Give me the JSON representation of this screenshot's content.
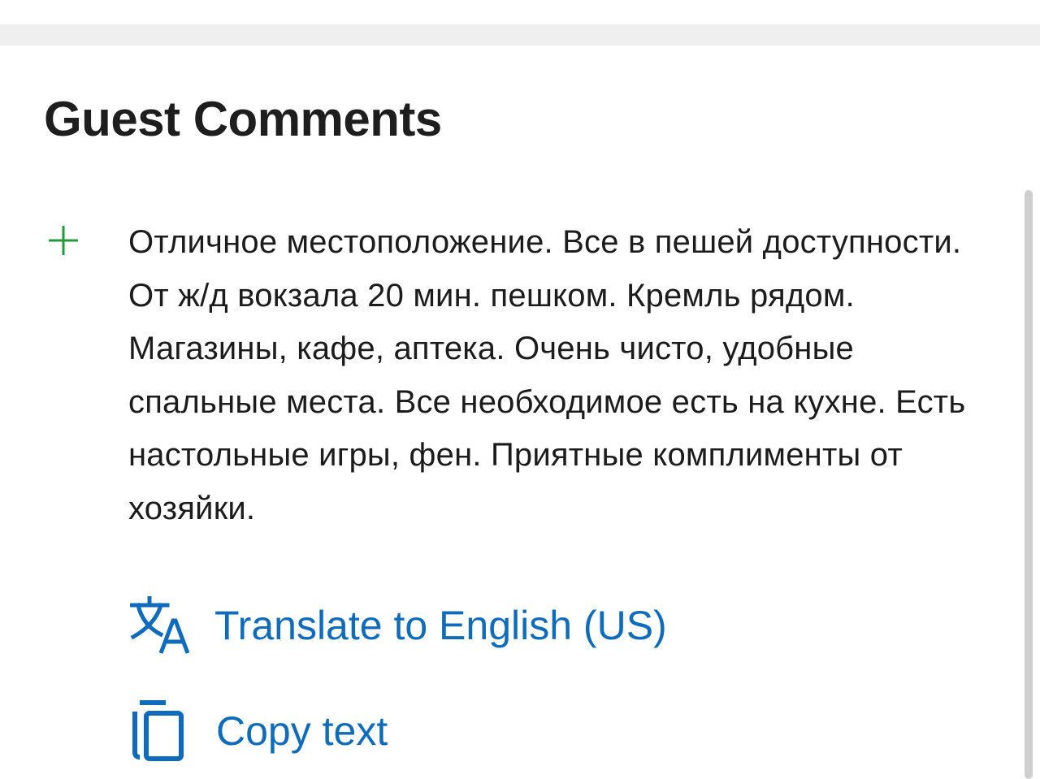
{
  "section": {
    "title": "Guest Comments"
  },
  "review": {
    "type_icon": "plus-icon",
    "text": "Отличное местоположение. Все в пешей доступности. От ж/д вокзала 20 мин. пешком. Кремль рядом. Магазины, кафе, аптека. Очень чисто, удобные спальные места. Все необходимое есть на кухне. Есть настольные игры, фен. Приятные комплименты от хозяйки."
  },
  "actions": {
    "translate": {
      "icon": "translate-icon",
      "label": "Translate to English (US)"
    },
    "copy": {
      "icon": "copy-icon",
      "label": "Copy text"
    }
  },
  "colors": {
    "accent": "#0f6cbd",
    "positive": "#1f9d3a",
    "heading": "#1e1e1e",
    "text": "#1c1c1c"
  }
}
